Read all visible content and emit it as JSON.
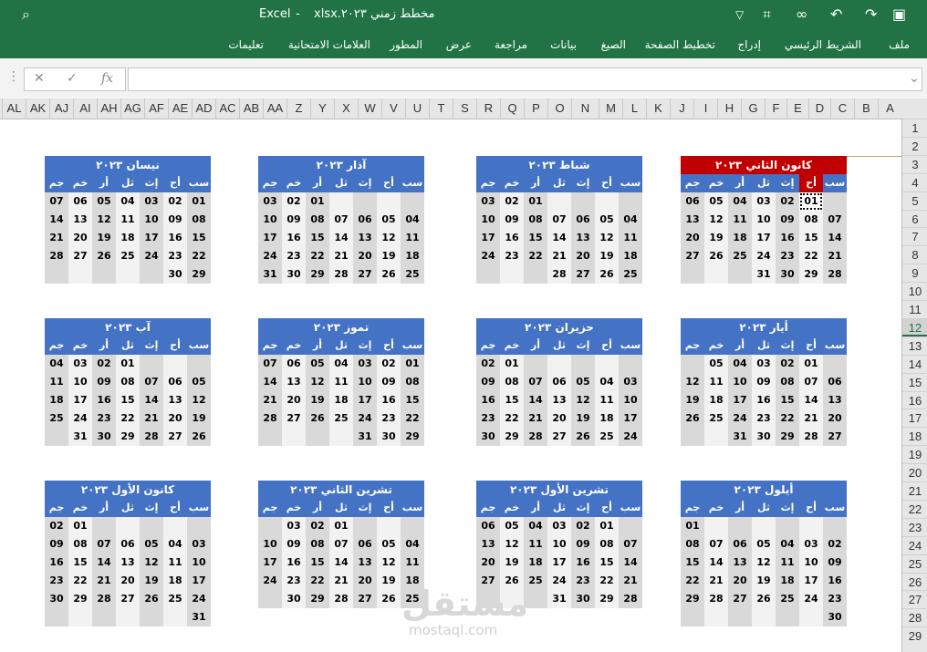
{
  "titlebar": {
    "app": "Excel",
    "sep": "-",
    "file": "مخطط زمني ٢٠٢٣.xlsx",
    "icons": [
      "search-icon",
      "undo-icon",
      "redo-icon",
      "touch-mode-icon",
      "crop-icon",
      "dropdown-icon",
      "save-icon"
    ]
  },
  "ribbon": {
    "tabs": [
      "ملف",
      "الشريط الرئيسي",
      "إدراج",
      "تخطيط الصفحة",
      "الصيغ",
      "بيانات",
      "مراجعة",
      "عرض",
      "المطور",
      "العلامات الامتحانية",
      "تعليمات"
    ]
  },
  "formula_bar": {
    "cancel": "✕",
    "confirm": "✓",
    "fx": "fx",
    "value": "",
    "expand": "⌄"
  },
  "columns": [
    "A",
    "B",
    "C",
    "D",
    "E",
    "F",
    "G",
    "H",
    "I",
    "J",
    "K",
    "L",
    "M",
    "N",
    "O",
    "P",
    "Q",
    "R",
    "S",
    "T",
    "U",
    "V",
    "W",
    "X",
    "Y",
    "Z",
    "AA",
    "AB",
    "AC",
    "AD",
    "AE",
    "AF",
    "AG",
    "AH",
    "AI",
    "AJ",
    "AK",
    "AL"
  ],
  "rows": [
    "1",
    "2",
    "3",
    "4",
    "5",
    "6",
    "7",
    "8",
    "9",
    "10",
    "11",
    "12",
    "13",
    "14",
    "15",
    "16",
    "17",
    "18",
    "19",
    "20",
    "21",
    "22",
    "23",
    "24",
    "25",
    "26",
    "27",
    "28",
    "29"
  ],
  "active_row": "12",
  "weekdays": [
    "سب",
    "أح",
    "إث",
    "ثل",
    "أر",
    "خم",
    "جم"
  ],
  "months": [
    {
      "title": "كانون الثاني  ٢٠٢٣",
      "rows": [
        [
          "",
          "01",
          "02",
          "03",
          "04",
          "05",
          "06"
        ],
        [
          "07",
          "08",
          "09",
          "10",
          "11",
          "12",
          "13"
        ],
        [
          "14",
          "15",
          "16",
          "17",
          "18",
          "19",
          "20"
        ],
        [
          "21",
          "22",
          "23",
          "24",
          "25",
          "26",
          "27"
        ],
        [
          "28",
          "29",
          "30",
          "31",
          "",
          "",
          ""
        ]
      ]
    },
    {
      "title": "شباط  ٢٠٢٣",
      "rows": [
        [
          "",
          "",
          "",
          "",
          "01",
          "02",
          "03"
        ],
        [
          "04",
          "05",
          "06",
          "07",
          "08",
          "09",
          "10"
        ],
        [
          "11",
          "12",
          "13",
          "14",
          "15",
          "16",
          "17"
        ],
        [
          "18",
          "19",
          "20",
          "21",
          "22",
          "23",
          "24"
        ],
        [
          "25",
          "26",
          "27",
          "28",
          "",
          "",
          ""
        ]
      ]
    },
    {
      "title": "آذار  ٢٠٢٣",
      "rows": [
        [
          "",
          "",
          "",
          "",
          "01",
          "02",
          "03"
        ],
        [
          "04",
          "05",
          "06",
          "07",
          "08",
          "09",
          "10"
        ],
        [
          "11",
          "12",
          "13",
          "14",
          "15",
          "16",
          "17"
        ],
        [
          "18",
          "19",
          "20",
          "21",
          "22",
          "23",
          "24"
        ],
        [
          "25",
          "26",
          "27",
          "28",
          "29",
          "30",
          "31"
        ]
      ]
    },
    {
      "title": "نيسان  ٢٠٢٣",
      "rows": [
        [
          "01",
          "02",
          "03",
          "04",
          "05",
          "06",
          "07"
        ],
        [
          "08",
          "09",
          "10",
          "11",
          "12",
          "13",
          "14"
        ],
        [
          "15",
          "16",
          "17",
          "18",
          "19",
          "20",
          "21"
        ],
        [
          "22",
          "23",
          "24",
          "25",
          "26",
          "27",
          "28"
        ],
        [
          "29",
          "30",
          "",
          "",
          "",
          "",
          ""
        ]
      ]
    },
    {
      "title": "أيار  ٢٠٢٣",
      "rows": [
        [
          "",
          "01",
          "02",
          "03",
          "04",
          "05",
          ""
        ],
        [
          "06",
          "07",
          "08",
          "09",
          "10",
          "11",
          "12"
        ],
        [
          "13",
          "14",
          "15",
          "16",
          "17",
          "18",
          "19"
        ],
        [
          "20",
          "21",
          "22",
          "23",
          "24",
          "25",
          "26"
        ],
        [
          "27",
          "28",
          "29",
          "30",
          "31",
          "",
          ""
        ]
      ]
    },
    {
      "title": "حزيران  ٢٠٢٣",
      "rows": [
        [
          "",
          "",
          "",
          "",
          "",
          "01",
          "02"
        ],
        [
          "03",
          "04",
          "05",
          "06",
          "07",
          "08",
          "09"
        ],
        [
          "10",
          "11",
          "12",
          "13",
          "14",
          "15",
          "16"
        ],
        [
          "17",
          "18",
          "19",
          "20",
          "21",
          "22",
          "23"
        ],
        [
          "24",
          "25",
          "26",
          "27",
          "28",
          "29",
          "30"
        ]
      ]
    },
    {
      "title": "تموز  ٢٠٢٣",
      "rows": [
        [
          "01",
          "02",
          "03",
          "04",
          "05",
          "06",
          "07"
        ],
        [
          "08",
          "09",
          "10",
          "11",
          "12",
          "13",
          "14"
        ],
        [
          "15",
          "16",
          "17",
          "18",
          "19",
          "20",
          "21"
        ],
        [
          "22",
          "23",
          "24",
          "25",
          "26",
          "27",
          "28"
        ],
        [
          "29",
          "30",
          "31",
          "",
          "",
          "",
          ""
        ]
      ]
    },
    {
      "title": "آب  ٢٠٢٣",
      "rows": [
        [
          "",
          "",
          "",
          "01",
          "02",
          "03",
          "04"
        ],
        [
          "05",
          "06",
          "07",
          "08",
          "09",
          "10",
          "11"
        ],
        [
          "12",
          "13",
          "14",
          "15",
          "16",
          "17",
          "18"
        ],
        [
          "19",
          "20",
          "21",
          "22",
          "23",
          "24",
          "25"
        ],
        [
          "26",
          "27",
          "28",
          "29",
          "30",
          "31",
          ""
        ]
      ]
    },
    {
      "title": "أيلول  ٢٠٢٣",
      "rows": [
        [
          "",
          "",
          "",
          "",
          "",
          "",
          "01"
        ],
        [
          "02",
          "03",
          "04",
          "05",
          "06",
          "07",
          "08"
        ],
        [
          "09",
          "10",
          "11",
          "12",
          "13",
          "14",
          "15"
        ],
        [
          "16",
          "17",
          "18",
          "19",
          "20",
          "21",
          "22"
        ],
        [
          "23",
          "24",
          "25",
          "26",
          "27",
          "28",
          "29"
        ],
        [
          "30",
          "",
          "",
          "",
          "",
          "",
          ""
        ]
      ]
    },
    {
      "title": "تشرين الأول  ٢٠٢٣",
      "rows": [
        [
          "",
          "01",
          "02",
          "03",
          "04",
          "05",
          "06"
        ],
        [
          "07",
          "08",
          "09",
          "10",
          "11",
          "12",
          "13"
        ],
        [
          "14",
          "15",
          "16",
          "17",
          "18",
          "19",
          "20"
        ],
        [
          "21",
          "22",
          "23",
          "24",
          "25",
          "26",
          "27"
        ],
        [
          "28",
          "29",
          "30",
          "31",
          "",
          "",
          ""
        ]
      ]
    },
    {
      "title": "تشرين الثاني  ٢٠٢٣",
      "rows": [
        [
          "",
          "",
          "",
          "01",
          "02",
          "03",
          ""
        ],
        [
          "04",
          "05",
          "06",
          "07",
          "08",
          "09",
          "10"
        ],
        [
          "11",
          "12",
          "13",
          "14",
          "15",
          "16",
          "17"
        ],
        [
          "18",
          "19",
          "20",
          "21",
          "22",
          "23",
          "24"
        ],
        [
          "25",
          "26",
          "27",
          "28",
          "29",
          "30",
          ""
        ]
      ]
    },
    {
      "title": "كانون الأول  ٢٠٢٣",
      "rows": [
        [
          "",
          "",
          "",
          "",
          "",
          "01",
          "02"
        ],
        [
          "03",
          "04",
          "05",
          "06",
          "07",
          "08",
          "09"
        ],
        [
          "10",
          "11",
          "12",
          "13",
          "14",
          "15",
          "16"
        ],
        [
          "17",
          "18",
          "19",
          "20",
          "21",
          "22",
          "23"
        ],
        [
          "24",
          "25",
          "26",
          "27",
          "28",
          "29",
          "30"
        ],
        [
          "31",
          "",
          "",
          "",
          "",
          "",
          ""
        ]
      ]
    }
  ],
  "watermark": {
    "logo": "مستقل",
    "site": "mostaql.com"
  },
  "colors": {
    "excel_green": "#217346",
    "header_blue": "#4472c4",
    "highlight_red": "#c00000",
    "cell_grey": "#d9d9d9"
  }
}
